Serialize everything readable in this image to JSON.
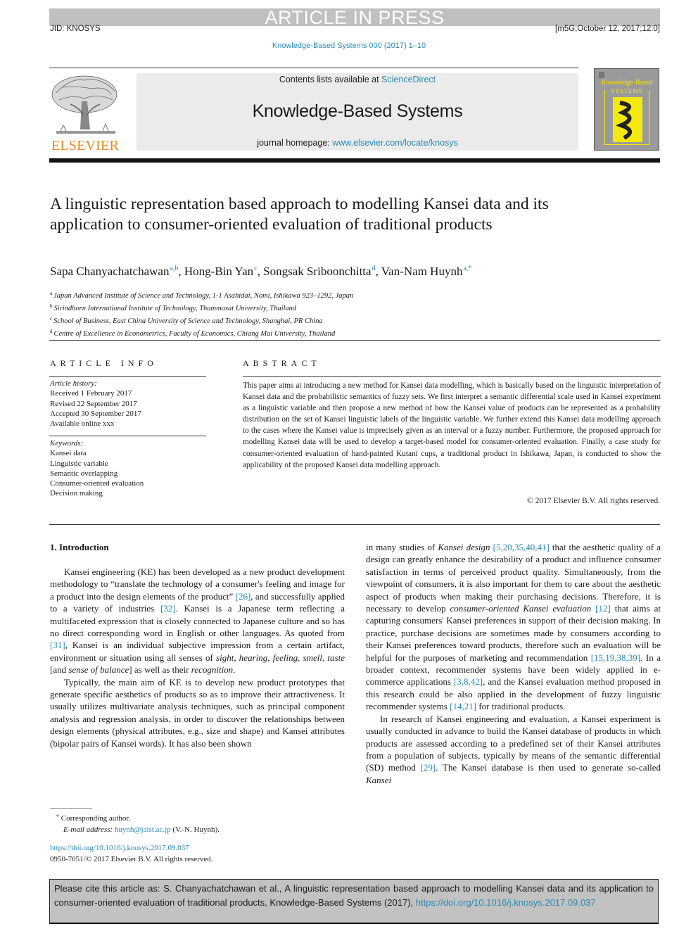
{
  "banner": "ARTICLE IN PRESS",
  "jid": "JID: KNOSYS",
  "stamp": "[m5G;October 12, 2017;12:0]",
  "journal_ref": "Knowledge-Based Systems 000 (2017) 1–10",
  "masthead": {
    "contents_prefix": "Contents lists available at ",
    "contents_link": "ScienceDirect",
    "journal_title": "Knowledge-Based Systems",
    "homepage_prefix": "journal homepage: ",
    "homepage_link": "www.elsevier.com/locate/knosys",
    "publisher": "ELSEVIER",
    "cover_title": "Knowledge-Based",
    "cover_subtitle": "SYSTEMS"
  },
  "article": {
    "title": "A linguistic representation based approach to modelling Kansei data and its application to consumer-oriented evaluation of traditional products",
    "authors": [
      {
        "name": "Sapa Chanyachatchawan",
        "aff": "a,b"
      },
      {
        "name": "Hong-Bin Yan",
        "aff": "c"
      },
      {
        "name": "Songsak Sriboonchitta",
        "aff": "d"
      },
      {
        "name": "Van-Nam Huynh",
        "aff": "a,*"
      }
    ],
    "affiliations": [
      {
        "key": "a",
        "text": "Japan Advanced Institute of Science and Technology, 1-1 Asahidai, Nomi, Ishikawa 923–1292, Japan"
      },
      {
        "key": "b",
        "text": "Sirindhorn International Institute of Technology, Thammasat University, Thailand"
      },
      {
        "key": "c",
        "text": "School of Business, East China University of Science and Technology, Shanghai, PR China"
      },
      {
        "key": "d",
        "text": "Centre of Excellence in Econometrics, Faculty of Economics, Chiang Mai University, Thailand"
      }
    ]
  },
  "article_info": {
    "heading": "ARTICLE INFO",
    "history_label": "Article history:",
    "history": [
      "Received 1 February 2017",
      "Revised 22 September 2017",
      "Accepted 30 September 2017",
      "Available online xxx"
    ],
    "keywords_label": "Keywords:",
    "keywords": [
      "Kansei data",
      "Linguistic variable",
      "Semantic overlapping",
      "Consumer-oriented evaluation",
      "Decision making"
    ]
  },
  "abstract": {
    "heading": "ABSTRACT",
    "text": "This paper aims at introducing a new method for Kansei data modelling, which is basically based on the linguistic interpretation of Kansei data and the probabilistic semantics of fuzzy sets. We first interpret a semantic differential scale used in Kansei experiment as a linguistic variable and then propose a new method of how the Kansei value of products can be represented as a probability distribution on the set of Kansei linguistic labels of the linguistic variable. We further extend this Kansei data modelling approach to the cases where the Kansei value is imprecisely given as an interval or a fuzzy number. Furthermore, the proposed approach for modelling Kansei data will be used to develop a target-based model for consumer-oriented evaluation. Finally, a case study for consumer-oriented evaluation of hand-painted Kutani cups, a traditional product in Ishikawa, Japan, is conducted to show the applicability of the proposed Kansei data modelling approach.",
    "copyright": "© 2017 Elsevier B.V. All rights reserved."
  },
  "intro": {
    "heading": "1. Introduction",
    "p1": [
      "Kansei engineering (KE) has been developed as a new product development methodology to “translate the technology of a consumer's feeling and image for a product into the design elements of the product” ",
      "[26]",
      ", and successfully applied to a variety of industries ",
      "[32]",
      ". Kansei is a Japanese term reflecting a multifaceted expression that is closely connected to Japanese culture and so has no direct corresponding word in English or other languages. As quoted from ",
      "[31]",
      ", Kansei is an individual subjective impression from a certain artifact, environment or situation using all senses of ",
      "sight, hearing, feeling, smell, taste",
      " [and ",
      "sense of balance",
      "] as well as their ",
      "recognition",
      "."
    ],
    "p2": "Typically, the main aim of KE is to develop new product prototypes that generate specific aesthetics of products so as to improve their attractiveness. It usually utilizes multivariate analysis techniques, such as principal component analysis and regression analysis, in order to discover the relationships between design elements (physical attributes, e.g., size and shape) and Kansei attributes (bipolar pairs of Kansei words). It has also been shown",
    "p3": [
      "in many studies of ",
      "Kansei design",
      " ",
      "[5,20,35,40,41]",
      " that the aesthetic quality of a design can greatly enhance the desirability of a product and influence consumer satisfaction in terms of perceived product quality. Simultaneously, from the viewpoint of consumers, it is also important for them to care about the aesthetic aspect of products when making their purchasing decisions. Therefore, it is necessary to develop ",
      "consumer-oriented Kansei evaluation",
      " ",
      "[12]",
      " that aims at capturing consumers' Kansei preferences in support of their decision making. In practice, purchase decisions are sometimes made by consumers according to their Kansei preferences toward products, therefore such an evaluation will be helpful for the purposes of marketing and recommendation ",
      "[15,19,38,39]",
      ". In a broader context, recommender systems have been widely applied in e-commerce applications ",
      "[3,8,42]",
      ", and the Kansei evaluation method proposed in this research could be also applied in the development of fuzzy linguistic recommender systems ",
      "[14,21]",
      " for traditional products."
    ],
    "p4": [
      "In research of Kansei engineering and evaluation, a Kansei experiment is usually conducted in advance to build the Kansei database of products in which products are assessed according to a predefined set of their Kansei attributes from a population of subjects, typically by means of the semantic differential (SD) method ",
      "[29]",
      ". The Kansei database is then used to generate so-called ",
      "Kansei"
    ]
  },
  "footnote": {
    "mark": "*",
    "corresponding": "Corresponding author.",
    "email_label": "E-mail address:",
    "email": "huynh@jaist.ac.jp",
    "email_suffix": "(V.-N. Huynh).",
    "doi": "https://doi.org/10.1016/j.knosys.2017.09.037",
    "issn": "0950-7051/© 2017 Elsevier B.V. All rights reserved."
  },
  "cite_box": {
    "text": "Please cite this article as: S. Chanyachatchawan et al., A linguistic representation based approach to modelling Kansei data and its application to consumer-oriented evaluation of traditional products, Knowledge-Based Systems (2017),",
    "doi": "https://doi.org/10.1016/j.knosys.2017.09.037"
  },
  "colors": {
    "link": "#2a8ab3",
    "publisher_orange": "#e8891e",
    "banner_gray": "#c0c0c0",
    "cover_yellow": "#f5e80f"
  }
}
